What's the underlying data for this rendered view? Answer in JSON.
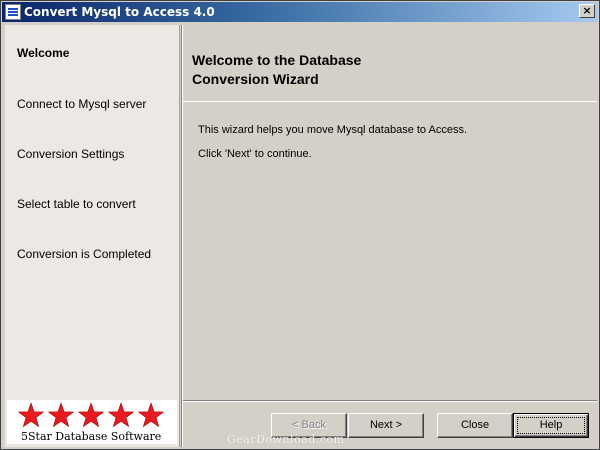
{
  "window": {
    "title": "Convert Mysql to Access 4.0",
    "close_label": "×"
  },
  "sidebar": {
    "items": [
      {
        "label": "Welcome",
        "active": true
      },
      {
        "label": "Connect to Mysql server",
        "active": false
      },
      {
        "label": "Conversion Settings",
        "active": false
      },
      {
        "label": "Select table to convert",
        "active": false
      },
      {
        "label": "Conversion is Completed",
        "active": false
      }
    ],
    "logo_text": "5Star Database Software",
    "logo_star_count": 5,
    "logo_star_color": "#e8191f"
  },
  "main": {
    "title_line1": "Welcome to the Database",
    "title_line2": "Conversion Wizard",
    "paragraphs": [
      "This wizard helps you move Mysql database to Access.",
      "Click 'Next' to continue."
    ]
  },
  "buttons": {
    "back": "< Back",
    "next": "Next >",
    "close": "Close",
    "help": "Help"
  },
  "watermark": "GearDownload.com",
  "colors": {
    "titlebar_start": "#0a246a",
    "titlebar_end": "#a6caf0",
    "face": "#d4d0c8",
    "sidebar": "#ece9e4"
  }
}
